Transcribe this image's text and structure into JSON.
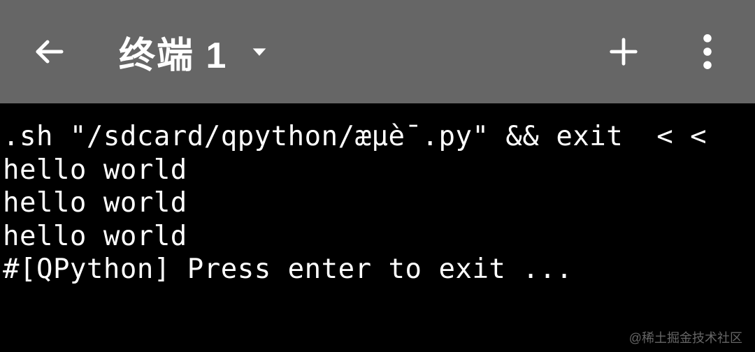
{
  "header": {
    "title": "终端 1"
  },
  "terminal": {
    "lines": [
      ".sh \"/sdcard/qpython/æµè¯.py\" && exit  < <",
      "hello world",
      "hello world",
      "hello world",
      "",
      "#[QPython] Press enter to exit ..."
    ]
  },
  "watermark": "@稀土掘金技术社区"
}
